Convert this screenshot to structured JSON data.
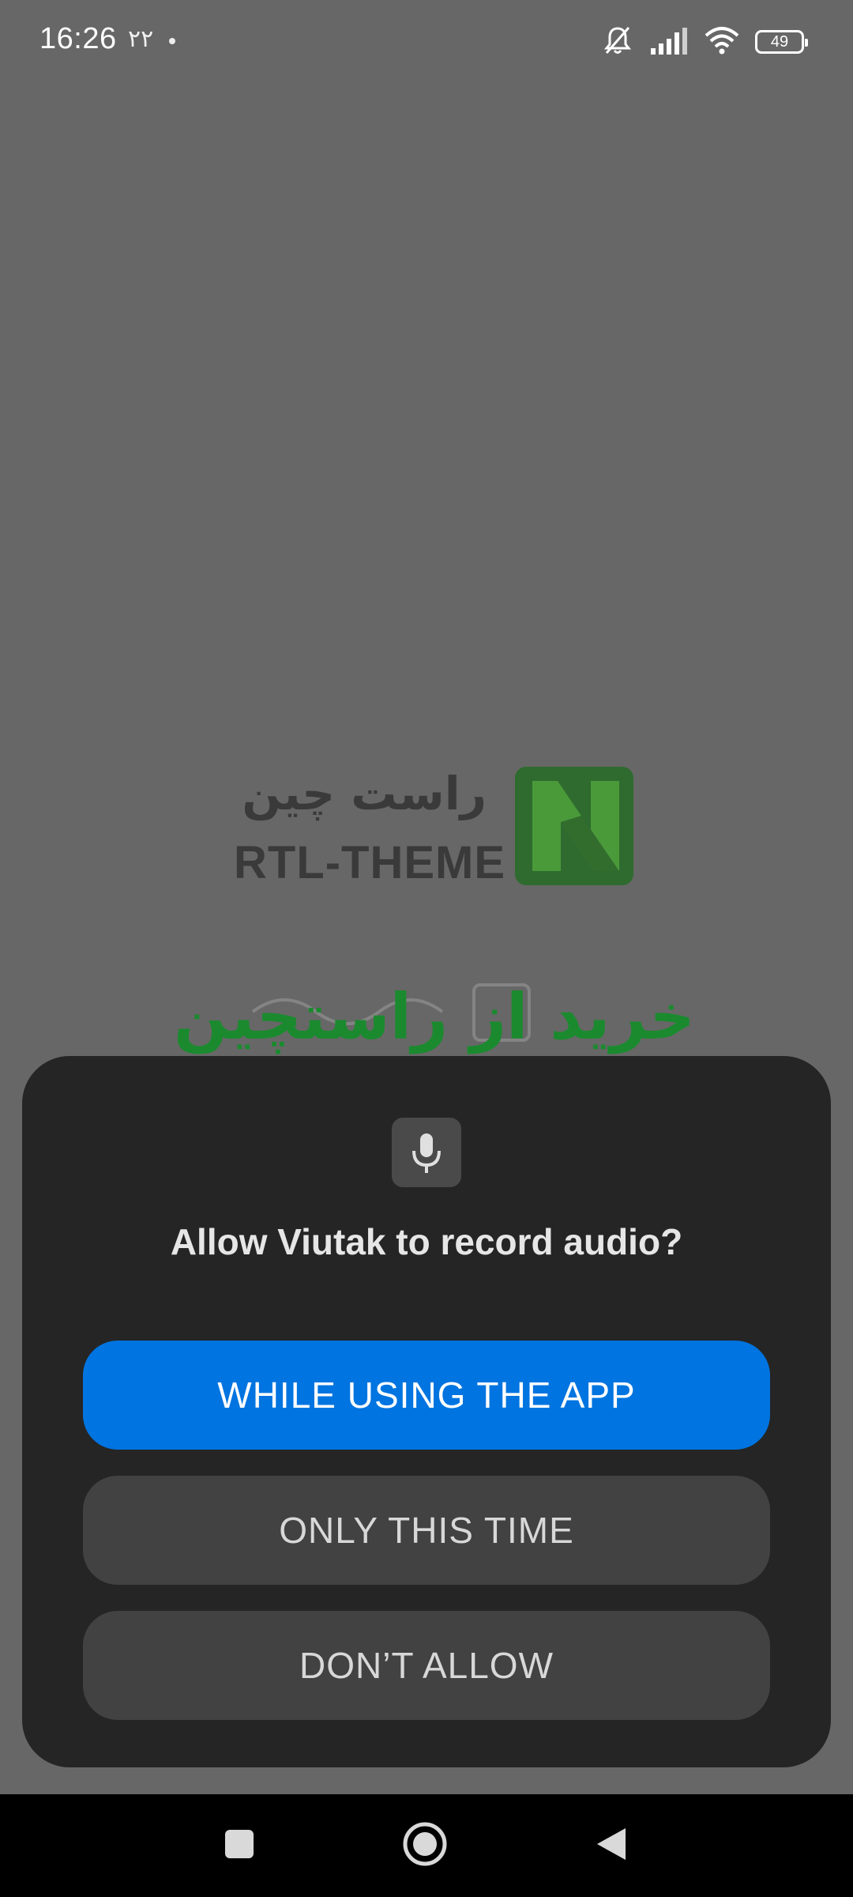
{
  "status_bar": {
    "time": "16:26",
    "date": "۲۲",
    "battery": "49",
    "icons": [
      "silent-bell-icon",
      "signal-icon",
      "wifi-icon",
      "battery-icon"
    ]
  },
  "background": {
    "logo_fa": "راست چین",
    "logo_en": "RTL-THEME",
    "promo_text": "خرید از راستچین",
    "logo_color": "#2f7d2f",
    "promo_color": "#1b8a2f"
  },
  "dialog": {
    "icon": "microphone-icon",
    "title": "Allow Viutak to record audio?",
    "buttons": {
      "while_using": "WHILE USING THE APP",
      "only_this_time": "ONLY THIS TIME",
      "dont_allow": "DON’T ALLOW"
    },
    "accent_color": "#0074e0"
  },
  "nav_bar": {
    "icons": [
      "recents-square-icon",
      "home-circle-icon",
      "back-triangle-icon"
    ]
  }
}
